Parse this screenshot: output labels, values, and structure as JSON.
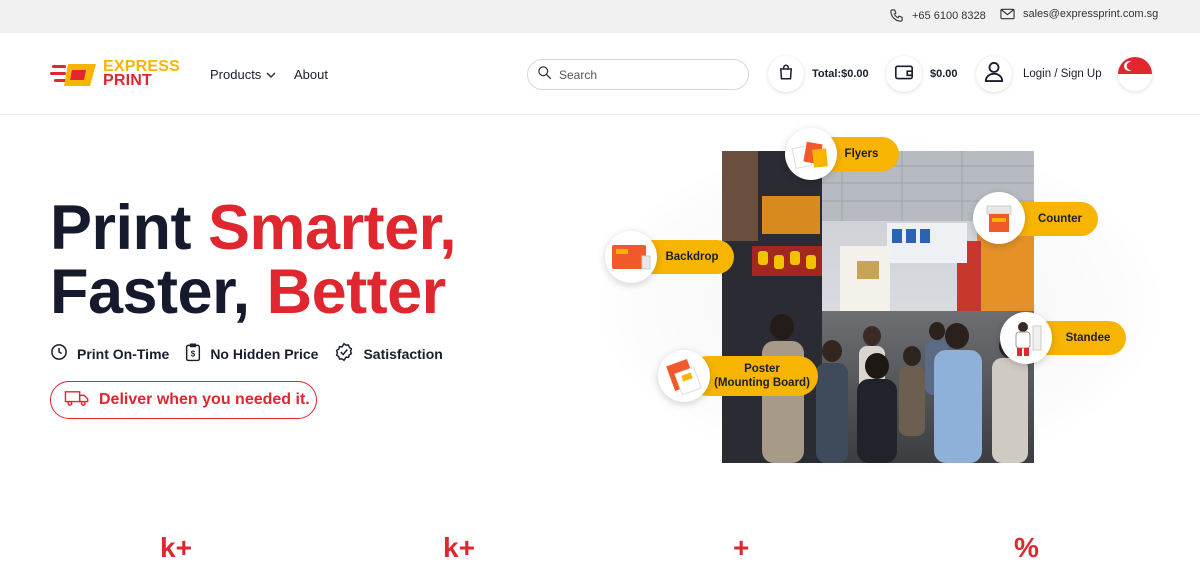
{
  "topbar": {
    "phone": "+65 6100 8328",
    "email": "sales@expressprint.com.sg"
  },
  "header": {
    "logo": {
      "line1": "EXPRESS",
      "line2": "PRINT"
    },
    "nav": {
      "products": "Products",
      "about": "About"
    },
    "search": {
      "placeholder": "Search"
    },
    "cart_total": "Total:$0.00",
    "wallet_amount": "$0.00",
    "login": "Login / Sign Up"
  },
  "hero": {
    "title_line1_a": "Print ",
    "title_line1_b": "Smarter,",
    "title_line2_a": "Faster, ",
    "title_line2_b": "Better",
    "features": [
      "Print On-Time",
      "No Hidden Price",
      "Satisfaction"
    ],
    "deliver": "Deliver when you needed it."
  },
  "products": {
    "flyers": "Flyers",
    "backdrop": "Backdrop",
    "counter": "Counter",
    "standee": "Standee",
    "poster_line1": "Poster",
    "poster_line2": "(Mounting Board)"
  },
  "stats": [
    "k+",
    "k+",
    "+",
    "%"
  ],
  "colors": {
    "brand_red": "#e0262e",
    "brand_yellow": "#f7b400",
    "dark": "#151a2c"
  }
}
